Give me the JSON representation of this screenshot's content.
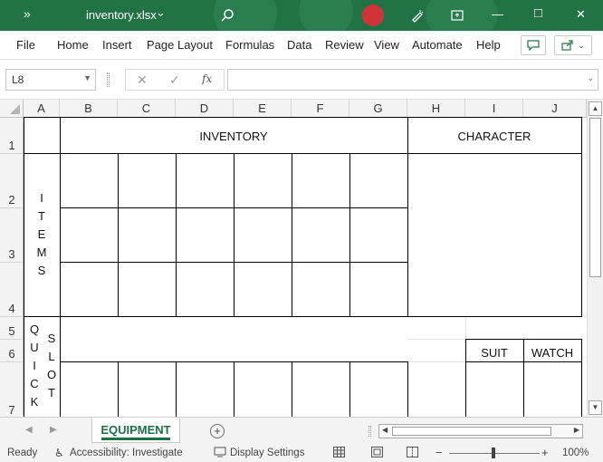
{
  "titlebar": {
    "chevron": "»",
    "filename": "inventory.xlsx",
    "dropdown": "⌄",
    "search_icon": "search-icon",
    "pen_icon": "pen-icon",
    "minimize": "—",
    "maximize": "□",
    "close": "✕",
    "accent": "#217346"
  },
  "menu": [
    "File",
    "Home",
    "Insert",
    "Page Layout",
    "Formulas",
    "Data",
    "Review",
    "View",
    "Automate",
    "Help"
  ],
  "formula_bar": {
    "name_box": "L8",
    "cancel": "✕",
    "enter": "✓",
    "fx": "fx",
    "value": ""
  },
  "columns": [
    "A",
    "B",
    "C",
    "D",
    "E",
    "F",
    "G",
    "H",
    "I",
    "J"
  ],
  "rows": [
    "1",
    "2",
    "3",
    "4",
    "5",
    "6",
    "7"
  ],
  "cells": {
    "inventory_title": "INVENTORY",
    "character_title": "CHARACTER",
    "items_letters": [
      "I",
      "T",
      "E",
      "M",
      "S"
    ],
    "quick_letters": [
      "Q",
      "U",
      "I",
      "C",
      "K"
    ],
    "slot_letters": [
      "S",
      "L",
      "O",
      "T"
    ],
    "suit": "SUIT",
    "watch": "WATCH"
  },
  "sheet_tabs": {
    "active": "EQUIPMENT",
    "add": "+"
  },
  "status": {
    "ready": "Ready",
    "accessibility": "Accessibility: Investigate",
    "display": "Display Settings",
    "zoom_minus": "−",
    "zoom_plus": "+",
    "zoom": "100%"
  }
}
